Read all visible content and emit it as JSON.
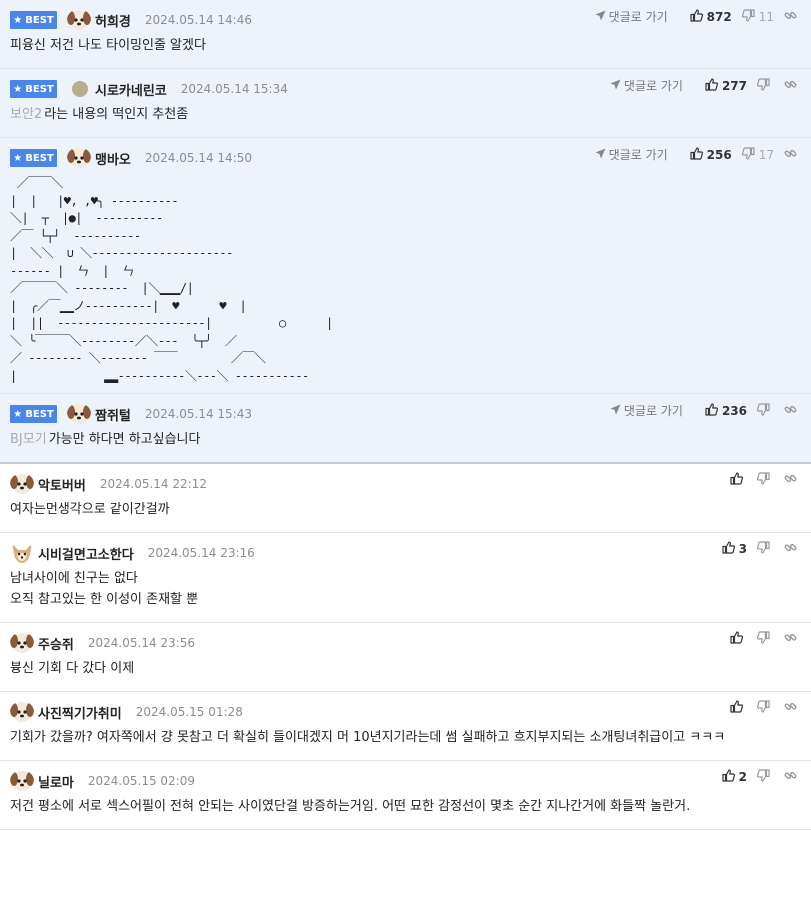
{
  "ui": {
    "best_label": "BEST",
    "reply_label": "댓글로 가기",
    "colors": {
      "best_badge": "#4a86e8",
      "best_bg": "#eef3fb"
    }
  },
  "comments": [
    {
      "best": true,
      "avatar": "dog-avatar-icon",
      "nick": "허희경",
      "date": "2024.05.14 14:46",
      "up": "872",
      "down": "11",
      "prefix": "",
      "lines": [
        "피융신 저건 나도 타이밍인줄 알겠다"
      ]
    },
    {
      "best": true,
      "avatar": "circle-avatar-icon",
      "nick": "시로카네린코",
      "date": "2024.05.14 15:34",
      "up": "277",
      "down": "",
      "prefix": "보안2",
      "lines": [
        "라는 내용의 떡인지 추천좀"
      ]
    },
    {
      "best": true,
      "avatar": "dog-avatar-icon",
      "nick": "맹바오",
      "date": "2024.05.14 14:50",
      "up": "256",
      "down": "17",
      "prefix": "",
      "ascii": " ／￣￣＼\n|  |   |♥, ,♥╮ ----------\n＼|  ┬  |●|  ----------\n／￣ └┬┘  ----------\n|  ＼＼  ∪ ＼---------------------\n------ |  ㄣ  |  ㄣ\n／￣￣￣＼ --------  |＼▁▁▁/|\n|  ╭／￣▁▁ノ----------|  ♥      ♥  |\n|  ||  ----------------------|          ○      |\n＼ ╰￣￣￣＼--------／＼---  ╰┬╯  ／\n／ -------- ＼------- ￣￣        ／￣＼\n|             ▂▂----------＼---＼ -----------"
    },
    {
      "best": true,
      "avatar": "dog-avatar-icon",
      "nick": "짬쥐털",
      "date": "2024.05.14 15:43",
      "up": "236",
      "down": "",
      "prefix": "BJ모기",
      "lines": [
        "가능만 하다면 하고싶습니다"
      ]
    },
    {
      "best": false,
      "avatar": "dog-avatar-icon",
      "nick": "악토버버",
      "date": "2024.05.14 22:12",
      "up": "",
      "down": "",
      "prefix": "",
      "lines": [
        "여자는먼생각으로 같이간걸까"
      ]
    },
    {
      "best": false,
      "avatar": "chihuahua-avatar-icon",
      "nick": "시비걸면고소한다",
      "date": "2024.05.14 23:16",
      "up": "3",
      "down": "",
      "prefix": "",
      "lines": [
        "남녀사이에 친구는 없다",
        "오직 참고있는 한 이성이 존재할 뿐"
      ]
    },
    {
      "best": false,
      "avatar": "dog-avatar-icon",
      "nick": "주승쥐",
      "date": "2024.05.14 23:56",
      "up": "",
      "down": "",
      "prefix": "",
      "lines": [
        "븅신 기회 다 갔다 이제"
      ]
    },
    {
      "best": false,
      "avatar": "dog-avatar-icon",
      "nick": "사진찍기가취미",
      "date": "2024.05.15 01:28",
      "up": "",
      "down": "",
      "prefix": "",
      "lines": [
        "기회가 갔을까? 여자쪽에서 걍 못참고 더 확실히 들이대겠지 머 10년지기라는데 썸 실패하고 흐지부지되는 소개팅녀취급이고 ㅋㅋㅋ"
      ]
    },
    {
      "best": false,
      "avatar": "dog-avatar-icon",
      "nick": "닐로마",
      "date": "2024.05.15 02:09",
      "up": "2",
      "down": "",
      "prefix": "",
      "lines": [
        "저건 평소에 서로 섹스어필이 전혀 안되는 사이였단걸 방증하는거임. 어떤 묘한 감정선이 몇초 순간 지나간거에 화들짝 놀란거."
      ]
    }
  ]
}
